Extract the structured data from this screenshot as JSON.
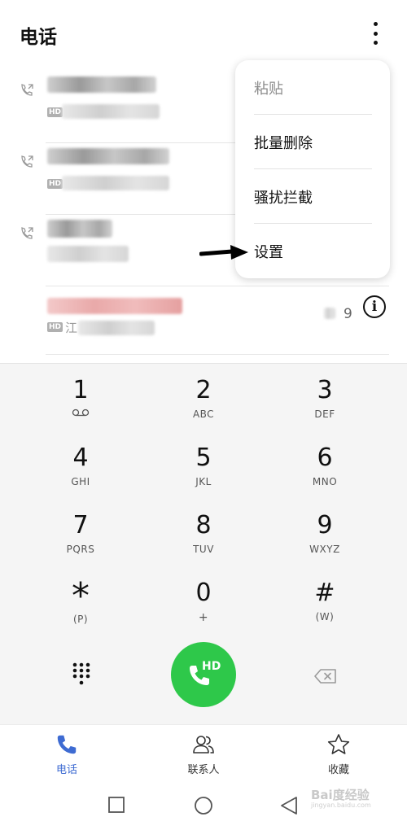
{
  "header": {
    "title": "电话",
    "more_icon": "more-vert-icon"
  },
  "calllog": {
    "rows": [
      {
        "hd_badge": "HD",
        "tail": "",
        "prefix": ""
      },
      {
        "hd_badge": "HD",
        "tail": "",
        "prefix": ""
      },
      {
        "hd_badge": "",
        "tail": "",
        "prefix": ""
      },
      {
        "hd_badge": "HD",
        "tail": "9",
        "prefix": "江",
        "info_icon": "i"
      }
    ]
  },
  "menu": {
    "items": [
      {
        "label": "粘贴",
        "enabled": false
      },
      {
        "label": "批量删除",
        "enabled": true
      },
      {
        "label": "骚扰拦截",
        "enabled": true
      },
      {
        "label": "设置",
        "enabled": true
      }
    ]
  },
  "dialpad": {
    "keys": [
      {
        "digit": "1",
        "letters": ""
      },
      {
        "digit": "2",
        "letters": "ABC"
      },
      {
        "digit": "3",
        "letters": "DEF"
      },
      {
        "digit": "4",
        "letters": "GHI"
      },
      {
        "digit": "5",
        "letters": "JKL"
      },
      {
        "digit": "6",
        "letters": "MNO"
      },
      {
        "digit": "7",
        "letters": "PQRS"
      },
      {
        "digit": "8",
        "letters": "TUV"
      },
      {
        "digit": "9",
        "letters": "WXYZ"
      },
      {
        "digit": "*",
        "letters": "(P)"
      },
      {
        "digit": "0",
        "letters": "+"
      },
      {
        "digit": "#",
        "letters": "(W)"
      }
    ],
    "call_button_label": "HD"
  },
  "bottom_nav": {
    "tabs": [
      {
        "label": "电话",
        "icon": "phone-icon",
        "active": true
      },
      {
        "label": "联系人",
        "icon": "contacts-icon",
        "active": false
      },
      {
        "label": "收藏",
        "icon": "star-icon",
        "active": false
      }
    ]
  },
  "watermark": {
    "text": "Bai度经验",
    "sub": "jingyan.baidu.com"
  },
  "colors": {
    "accent": "#3e6bd2",
    "call_green": "#2ec84a",
    "pad_bg": "#f5f5f5"
  }
}
